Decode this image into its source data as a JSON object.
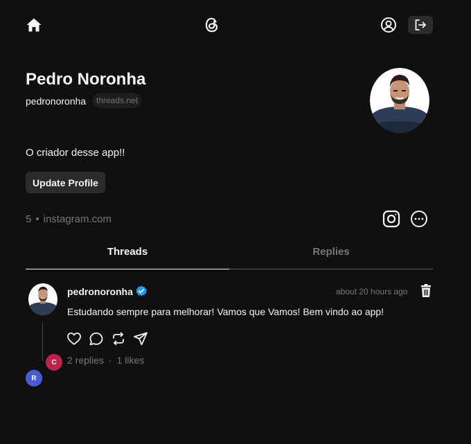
{
  "nav": {
    "home_icon": "home-icon",
    "logo_icon": "threads-logo-icon",
    "profile_icon": "user-circle-icon",
    "logout_icon": "logout-icon"
  },
  "profile": {
    "name": "Pedro Noronha",
    "username": "pedronoronha",
    "domain_badge": "threads.net",
    "bio": "O criador desse app!!",
    "update_button": "Update Profile",
    "followers_count": "5",
    "link": "instagram.com"
  },
  "tabs": [
    {
      "label": "Threads",
      "active": true
    },
    {
      "label": "Replies",
      "active": false
    }
  ],
  "post": {
    "username": "pedronoronha",
    "verified": true,
    "time": "about 20 hours ago",
    "text": "Estudando sempre para melhorar! Vamos que Vamos! Bem vindo ao app!",
    "replies": "2 replies",
    "likes": "1 likes",
    "reply_avatars": [
      {
        "initial": "C",
        "color": "#c0234a"
      },
      {
        "initial": "R",
        "color": "#4a5bd8"
      }
    ]
  },
  "colors": {
    "background": "#101010",
    "text": "#f3f5f7",
    "muted": "#777777",
    "verified": "#1d9bf0"
  }
}
